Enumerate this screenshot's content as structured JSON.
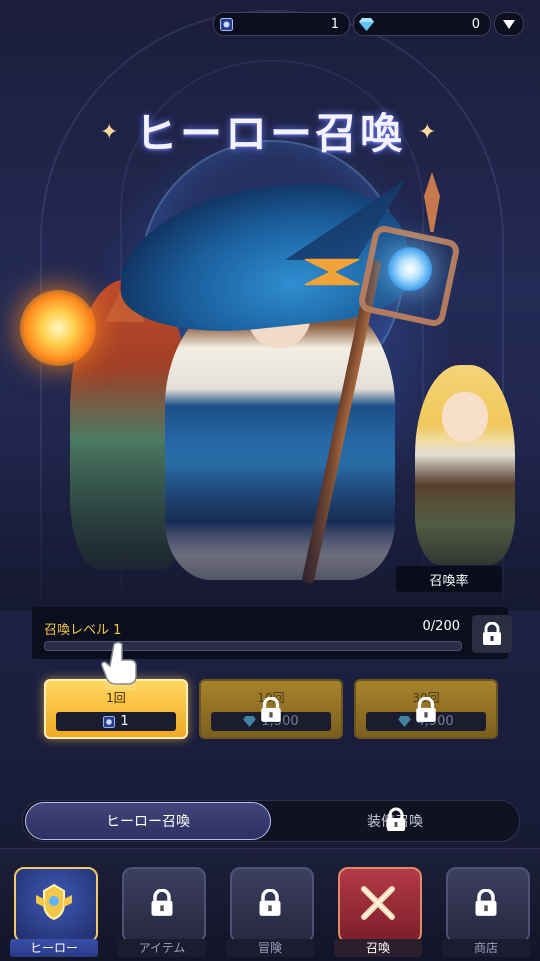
{
  "currency": {
    "ticket": {
      "icon": "summon-ticket-icon",
      "value": "1"
    },
    "gem": {
      "icon": "gem-icon",
      "value": "0"
    },
    "menu_icon": "dropdown-triangle-icon"
  },
  "title": "ヒーロー召喚",
  "summon_rate_label": "召喚率",
  "level": {
    "name": "召喚レベル 1",
    "progress_text": "0/200",
    "progress_fraction": 0
  },
  "summon_buttons": [
    {
      "label": "1回",
      "cost": "1",
      "cost_icon": "summon-ticket-icon",
      "locked": false
    },
    {
      "label": "10回",
      "cost": "1,500",
      "cost_icon": "gem-icon",
      "locked": true
    },
    {
      "label": "30回",
      "cost": "4,500",
      "cost_icon": "gem-icon",
      "locked": true
    }
  ],
  "tabs": {
    "hero": "ヒーロー召喚",
    "equipment": "装備召喚"
  },
  "nav": [
    {
      "label": "ヒーロー",
      "icon": "hero-helmet-icon",
      "locked": false
    },
    {
      "label": "アイテム",
      "icon": "item-icon",
      "locked": true
    },
    {
      "label": "冒険",
      "icon": "adventure-icon",
      "locked": true
    },
    {
      "label": "召喚",
      "icon": "summon-crossed-swords-icon",
      "locked": false
    },
    {
      "label": "商店",
      "icon": "shop-icon",
      "locked": true
    }
  ],
  "colors": {
    "accent_gold": "#f2c94c",
    "active_tab": "#2d3062",
    "summon_red": "#b33a46"
  }
}
